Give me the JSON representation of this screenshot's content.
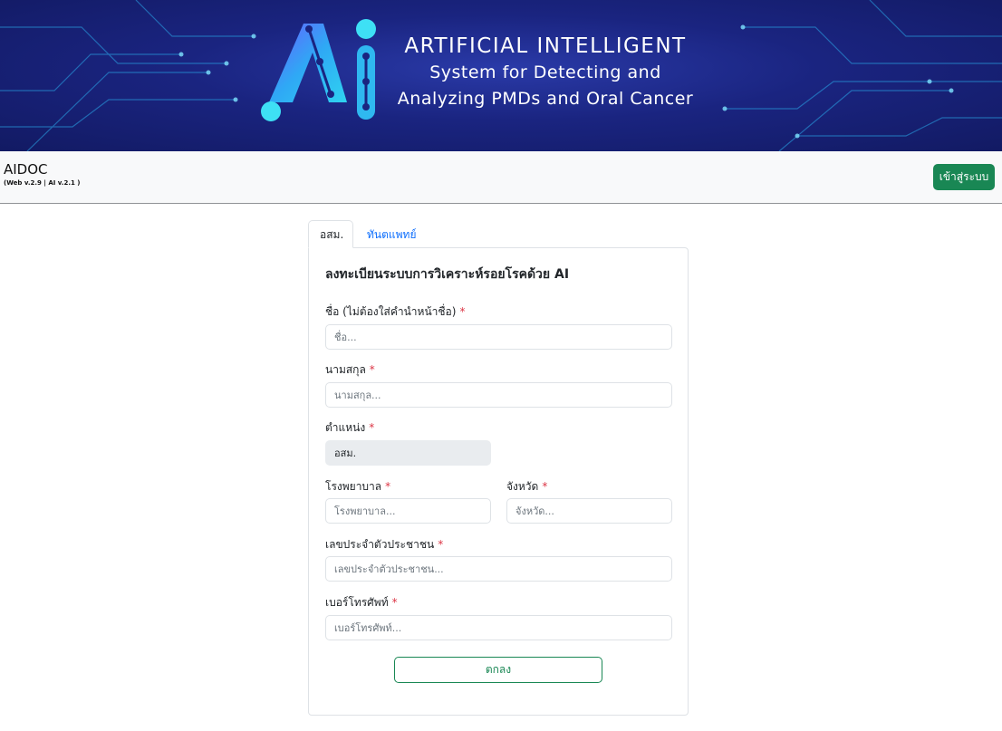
{
  "banner": {
    "logo_text": "Ai",
    "title": "ARTIFICIAL INTELLIGENT",
    "subtitle_line1": "System for Detecting and",
    "subtitle_line2": "Analyzing PMDs and Oral Cancer"
  },
  "navbar": {
    "brand": "AIDOC",
    "version": "(Web v.2.9 | AI v.2.1 )",
    "login_label": "เข้าสู่ระบบ"
  },
  "tabs": [
    {
      "label": "อสม.",
      "active": true
    },
    {
      "label": "ทันตแพทย์",
      "active": false
    }
  ],
  "form": {
    "title": "ลงทะเบียนระบบการวิเคราะห์รอยโรคด้วย AI",
    "required_mark": "*",
    "fields": {
      "first_name": {
        "label": "ชื่อ (ไม่ต้องใส่คำนำหน้าชื่อ)",
        "placeholder": "ชื่อ...",
        "value": ""
      },
      "last_name": {
        "label": "นามสกุล",
        "placeholder": "นามสกุล...",
        "value": ""
      },
      "position": {
        "label": "ตำแหน่ง",
        "value": "อสม."
      },
      "hospital": {
        "label": "โรงพยาบาล",
        "placeholder": "โรงพยาบาล...",
        "value": ""
      },
      "province": {
        "label": "จังหวัด",
        "placeholder": "จังหวัด...",
        "value": ""
      },
      "citizen_id": {
        "label": "เลขประจำตัวประชาชน",
        "placeholder": "เลขประจำตัวประชาชน...",
        "value": ""
      },
      "phone": {
        "label": "เบอร์โทรศัพท์",
        "placeholder": "เบอร์โทรศัพท์...",
        "value": ""
      }
    },
    "submit_label": "ตกลง"
  },
  "colors": {
    "primary_green": "#198754",
    "link_blue": "#0d6efd",
    "required_red": "#dc3545",
    "banner_blue": "#1a2480",
    "logo_cyan": "#2fd3f0"
  }
}
